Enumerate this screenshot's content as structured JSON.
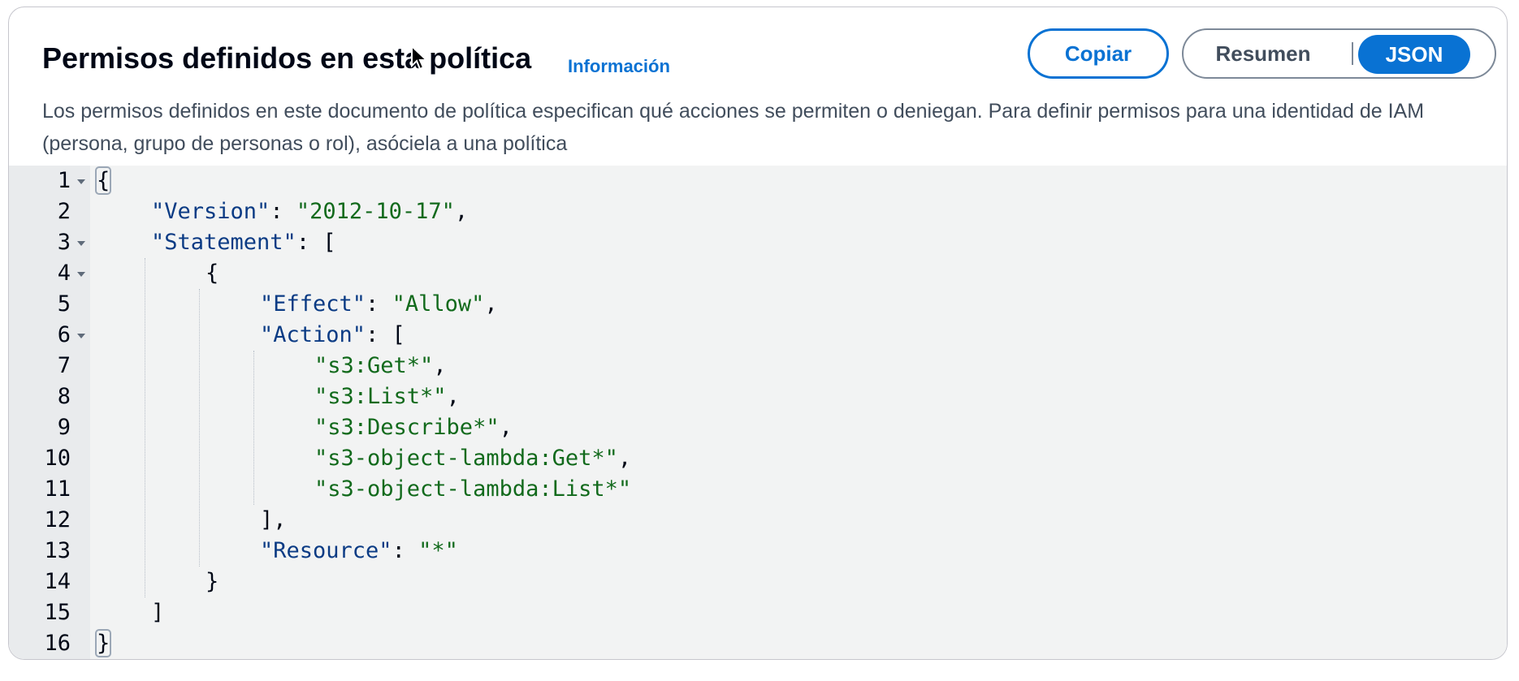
{
  "header": {
    "title": "Permisos definidos en esta política",
    "info_link": "Información",
    "description": "Los permisos definidos en este documento de política especifican qué acciones se permiten o deniegan. Para definir permisos para una identidad de IAM (persona, grupo de personas o rol), asóciela a una política",
    "copy_label": "Copiar",
    "view_toggle": {
      "options": [
        "Resumen",
        "JSON"
      ],
      "selected": "JSON"
    }
  },
  "editor": {
    "lines": [
      {
        "n": "1",
        "indent": 0,
        "foldable": true,
        "tokens": [
          {
            "t": "{",
            "c": "punc",
            "box": true
          }
        ]
      },
      {
        "n": "2",
        "indent": 1,
        "foldable": false,
        "tokens": [
          {
            "t": "\"Version\"",
            "c": "key"
          },
          {
            "t": ": ",
            "c": "punc"
          },
          {
            "t": "\"2012-10-17\"",
            "c": "str"
          },
          {
            "t": ",",
            "c": "punc"
          }
        ]
      },
      {
        "n": "3",
        "indent": 1,
        "foldable": true,
        "tokens": [
          {
            "t": "\"Statement\"",
            "c": "key"
          },
          {
            "t": ": [",
            "c": "punc"
          }
        ]
      },
      {
        "n": "4",
        "indent": 2,
        "foldable": true,
        "tokens": [
          {
            "t": "{",
            "c": "punc"
          }
        ]
      },
      {
        "n": "5",
        "indent": 3,
        "foldable": false,
        "tokens": [
          {
            "t": "\"Effect\"",
            "c": "key"
          },
          {
            "t": ": ",
            "c": "punc"
          },
          {
            "t": "\"Allow\"",
            "c": "str"
          },
          {
            "t": ",",
            "c": "punc"
          }
        ]
      },
      {
        "n": "6",
        "indent": 3,
        "foldable": true,
        "tokens": [
          {
            "t": "\"Action\"",
            "c": "key"
          },
          {
            "t": ": [",
            "c": "punc"
          }
        ]
      },
      {
        "n": "7",
        "indent": 4,
        "foldable": false,
        "tokens": [
          {
            "t": "\"s3:Get*\"",
            "c": "str"
          },
          {
            "t": ",",
            "c": "punc"
          }
        ]
      },
      {
        "n": "8",
        "indent": 4,
        "foldable": false,
        "tokens": [
          {
            "t": "\"s3:List*\"",
            "c": "str"
          },
          {
            "t": ",",
            "c": "punc"
          }
        ]
      },
      {
        "n": "9",
        "indent": 4,
        "foldable": false,
        "tokens": [
          {
            "t": "\"s3:Describe*\"",
            "c": "str"
          },
          {
            "t": ",",
            "c": "punc"
          }
        ]
      },
      {
        "n": "10",
        "indent": 4,
        "foldable": false,
        "tokens": [
          {
            "t": "\"s3-object-lambda:Get*\"",
            "c": "str"
          },
          {
            "t": ",",
            "c": "punc"
          }
        ]
      },
      {
        "n": "11",
        "indent": 4,
        "foldable": false,
        "tokens": [
          {
            "t": "\"s3-object-lambda:List*\"",
            "c": "str"
          }
        ]
      },
      {
        "n": "12",
        "indent": 3,
        "foldable": false,
        "tokens": [
          {
            "t": "],",
            "c": "punc"
          }
        ]
      },
      {
        "n": "13",
        "indent": 3,
        "foldable": false,
        "tokens": [
          {
            "t": "\"Resource\"",
            "c": "key"
          },
          {
            "t": ": ",
            "c": "punc"
          },
          {
            "t": "\"*\"",
            "c": "str"
          }
        ]
      },
      {
        "n": "14",
        "indent": 2,
        "foldable": false,
        "tokens": [
          {
            "t": "}",
            "c": "punc"
          }
        ]
      },
      {
        "n": "15",
        "indent": 1,
        "foldable": false,
        "tokens": [
          {
            "t": "]",
            "c": "punc"
          }
        ]
      },
      {
        "n": "16",
        "indent": 0,
        "foldable": false,
        "tokens": [
          {
            "t": "}",
            "c": "punc",
            "box": true
          }
        ]
      }
    ]
  }
}
